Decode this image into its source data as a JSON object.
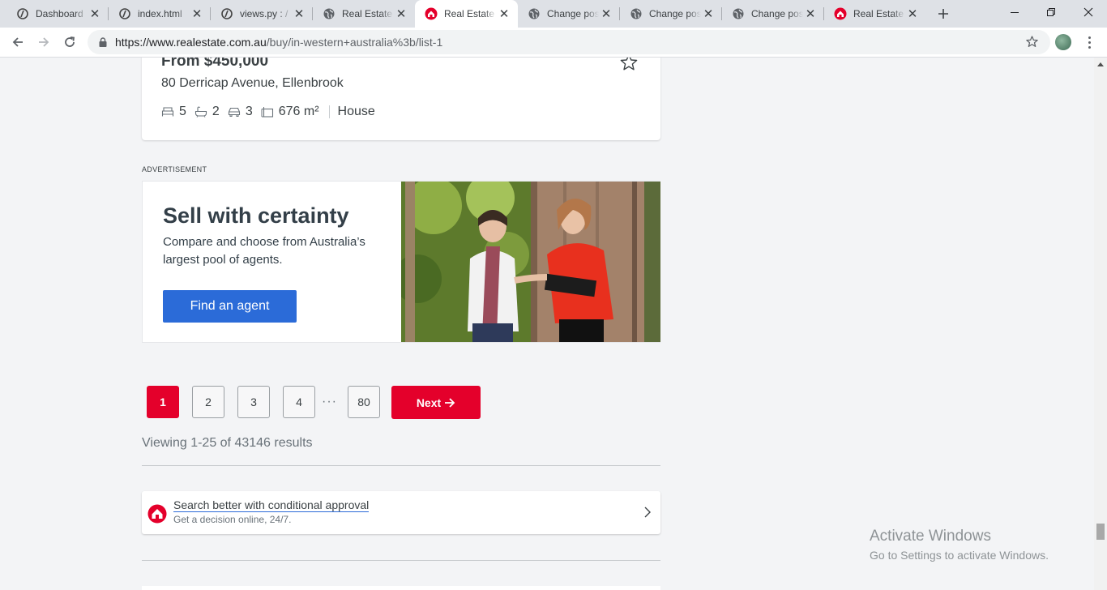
{
  "browser": {
    "tabs": [
      {
        "label": "Dashboard",
        "icon": "django-icon"
      },
      {
        "label": "index.html",
        "icon": "django-icon"
      },
      {
        "label": "views.py : /",
        "icon": "django-icon"
      },
      {
        "label": "Real Estate",
        "icon": "globe-icon"
      },
      {
        "label": "Real Estate",
        "icon": "rea-house-icon"
      },
      {
        "label": "Change pos",
        "icon": "globe-icon"
      },
      {
        "label": "Change pos",
        "icon": "globe-icon"
      },
      {
        "label": "Change pos",
        "icon": "globe-icon"
      },
      {
        "label": "Real Estate",
        "icon": "rea-house-icon"
      }
    ],
    "url_host": "https://www.realestate.com.au",
    "url_path": "/buy/in-western+australia%3b/list-1"
  },
  "listing": {
    "price": "From $450,000",
    "address": "80 Derricap Avenue, Ellenbrook",
    "bedrooms": "5",
    "bathrooms": "2",
    "car_spaces": "3",
    "land_size": "676 m²",
    "property_type": "House"
  },
  "ad": {
    "label": "ADVERTISEMENT",
    "heading": "Sell with certainty",
    "text": "Compare and choose from Australia’s largest pool of agents.",
    "button": "Find an agent"
  },
  "pagination": {
    "pages": [
      "1",
      "2",
      "3",
      "4"
    ],
    "ellipsis": "···",
    "last": "80",
    "next": "Next",
    "current": "1"
  },
  "results_text": "Viewing 1-25 of 43146 results",
  "promo": {
    "title": "Search better with conditional approval",
    "subtitle": "Get a decision online, 24/7."
  },
  "watermark": {
    "line1": "Activate Windows",
    "line2": "Go to Settings to activate Windows."
  },
  "colors": {
    "brand_red": "#e4002b",
    "button_blue": "#2b6bd8",
    "text_dark": "#3b4144",
    "page_bg": "#f3f4f6"
  }
}
